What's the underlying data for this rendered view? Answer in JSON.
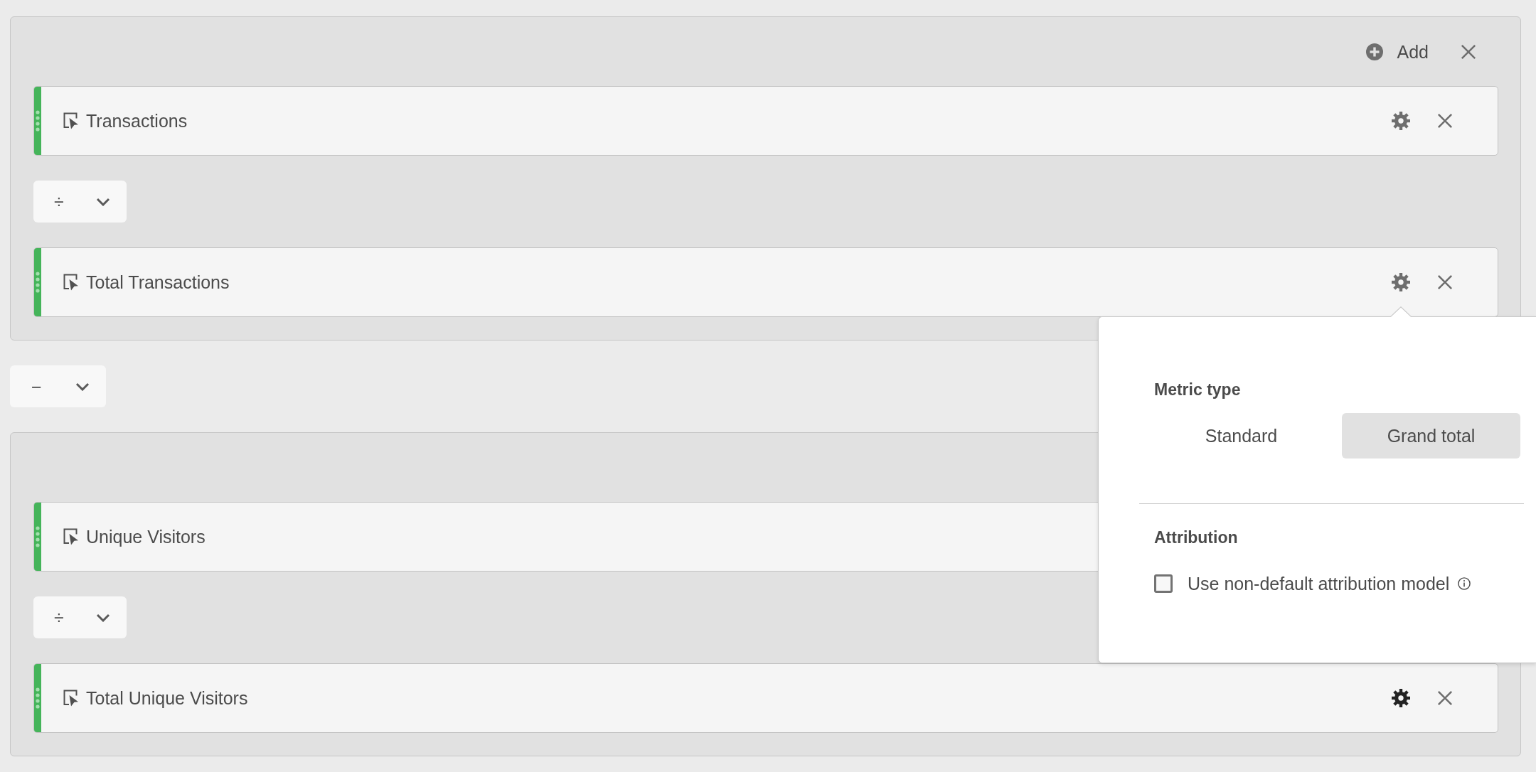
{
  "items": [
    {
      "kind": "group",
      "header": {
        "add_label": "Add"
      },
      "items": [
        {
          "kind": "metric",
          "name": "Transactions",
          "controls": [
            {
              "kind": "settings",
              "highlighted": false
            },
            {
              "kind": "remove"
            }
          ]
        },
        {
          "kind": "operator",
          "symbol": "÷"
        },
        {
          "kind": "metric",
          "name": "Total Transactions",
          "controls": [
            {
              "kind": "settings",
              "highlighted": false
            },
            {
              "kind": "remove"
            }
          ]
        }
      ]
    },
    {
      "kind": "operator",
      "symbol": "−"
    },
    {
      "kind": "group",
      "items": [
        {
          "kind": "metric",
          "name": "Unique Visitors"
        },
        {
          "kind": "operator",
          "symbol": "÷"
        },
        {
          "kind": "metric",
          "name": "Total Unique Visitors",
          "controls": [
            {
              "kind": "settings",
              "highlighted": true
            },
            {
              "kind": "remove"
            }
          ]
        }
      ]
    }
  ],
  "popover": {
    "sections": [
      {
        "kind": "segmented",
        "title": "Metric type",
        "options": [
          {
            "label": "Standard",
            "selected": false
          },
          {
            "label": "Grand total",
            "selected": true
          }
        ]
      },
      {
        "kind": "checkbox",
        "title": "Attribution",
        "label": "Use non-default attribution model",
        "checked": false
      }
    ]
  }
}
